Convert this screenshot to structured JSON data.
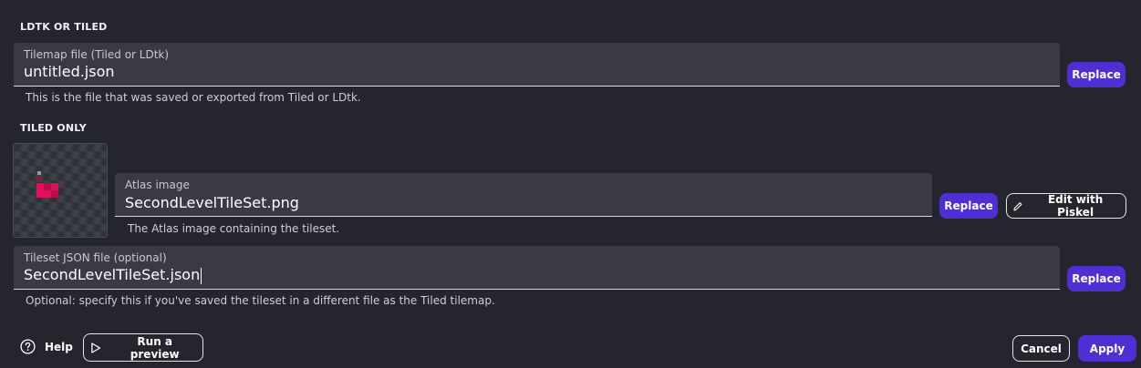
{
  "sections": {
    "ldtk_or_tiled": "LDTK OR TILED",
    "tiled_only": "TILED ONLY"
  },
  "tilemap": {
    "label": "Tilemap file (Tiled or LDtk)",
    "value": "untitled.json",
    "helper": "This is the file that was saved or exported from Tiled or LDtk.",
    "replace_label": "Replace"
  },
  "atlas": {
    "label": "Atlas image",
    "value": "SecondLevelTileSet.png",
    "helper": "The Atlas image containing the tileset.",
    "replace_label": "Replace",
    "edit_label": "Edit with Piskel"
  },
  "tileset": {
    "label": "Tileset JSON file (optional)",
    "value": "SecondLevelTileSet.json",
    "helper": "Optional: specify this if you've saved the tileset in a different file as the Tiled tilemap.",
    "replace_label": "Replace"
  },
  "footer": {
    "help_label": "Help",
    "preview_label": "Run a preview",
    "cancel_label": "Cancel",
    "apply_label": "Apply"
  },
  "colors": {
    "background": "#25252e",
    "field": "#3a3a45",
    "accent": "#4f2fd3",
    "tile_pink": "#e0105a"
  },
  "icons": {
    "help": "help-circle-icon",
    "preview": "play-icon",
    "edit": "pencil-icon"
  }
}
